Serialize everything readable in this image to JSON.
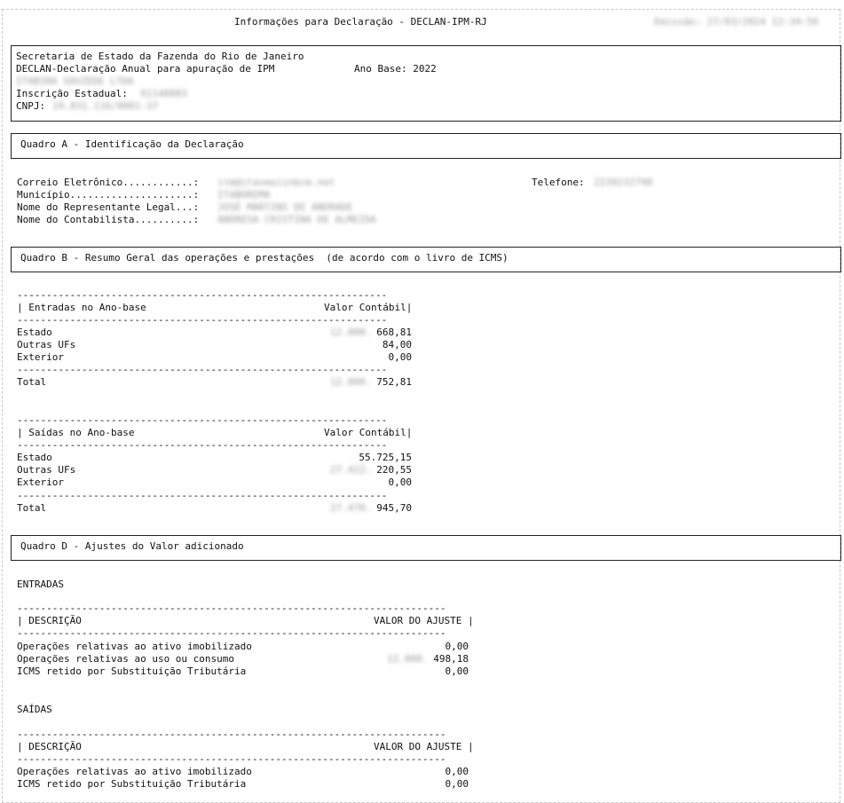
{
  "header": {
    "title": "Informações para Declaração - DECLAN-IPM-RJ",
    "emission": "Emissão: 27/03/2024 12:34:56"
  },
  "info": {
    "line1": "Secretaria de Estado da Fazenda do Rio de Janeiro",
    "line2": "DECLAN-Declaração Anual para apuração de IPM",
    "ano_base": "Ano Base: 2022",
    "company": "ITABIRA SOUZEDE LTDA",
    "inscricao_label": "Inscrição Estadual:",
    "inscricao_value": "91148883",
    "cnpj_label": "CNPJ:",
    "cnpj_value": "19.831.116/0001-37"
  },
  "quadro_a": {
    "title": "Quadro A - Identificação da Declaração",
    "email_label": "Correio Eletrônico............:",
    "email_value": "itm@itasmoiinbcm.net",
    "telefone_label": "Telefone:",
    "telefone_value": "2239232798",
    "municipio_label": "Município.....................:",
    "municipio_value": "ITABOREMA",
    "representante_label": "Nome do Representante Legal...:",
    "representante_value": "JOSÉ MARTINS DE ANDRADE",
    "contabilista_label": "Nome do Contabilista..........:",
    "contabilista_value": "ANDRESA CRISTINA DE ALMEIDA"
  },
  "quadro_b": {
    "title": "Quadro B - Resumo Geral das operações e prestações  (de acordo com o livro de ICMS)",
    "rule": "---------------------------------------------------------------",
    "entradas": {
      "header_left": "| Entradas no Ano-base",
      "header_right": "Valor Contábil|",
      "rows": [
        {
          "label": "Estado",
          "hidden": "12.000.",
          "value": "668,81"
        },
        {
          "label": "Outras UFs",
          "hidden": "",
          "value": "84,00"
        },
        {
          "label": "Exterior",
          "hidden": "",
          "value": "0,00"
        }
      ],
      "total_label": "Total",
      "total_hidden": "12.000.",
      "total_value": "752,81"
    },
    "saidas": {
      "header_left": "| Saídas no Ano-base",
      "header_right": "Valor Contábil|",
      "rows": [
        {
          "label": "Estado",
          "hidden": "",
          "value": "55.725,15"
        },
        {
          "label": "Outras UFs",
          "hidden": "27.422.",
          "value": "220,55"
        },
        {
          "label": "Exterior",
          "hidden": "",
          "value": "0,00"
        }
      ],
      "total_label": "Total",
      "total_hidden": "27.470.",
      "total_value": "945,70"
    }
  },
  "quadro_d": {
    "title": "Quadro D - Ajustes do Valor adicionado",
    "rule": "-------------------------------------------------------------------------",
    "header_left": "| DESCRIÇÃO",
    "header_right": "VALOR DO AJUSTE |",
    "entradas_label": "ENTRADAS",
    "entradas_rows": [
      {
        "label": "Operações relativas ao ativo imobilizado",
        "hidden": "",
        "value": "0,00"
      },
      {
        "label": "Operações relativas ao uso ou consumo",
        "hidden": "12.008.",
        "value": "498,18"
      },
      {
        "label": "ICMS retido por Substituição Tributária",
        "hidden": "",
        "value": "0,00"
      }
    ],
    "saidas_label": "SAÍDAS",
    "saidas_rows": [
      {
        "label": "Operações relativas ao ativo imobilizado",
        "hidden": "",
        "value": "0,00"
      },
      {
        "label": "ICMS retido por Substituição Tributária",
        "hidden": "",
        "value": "0,00"
      }
    ]
  }
}
